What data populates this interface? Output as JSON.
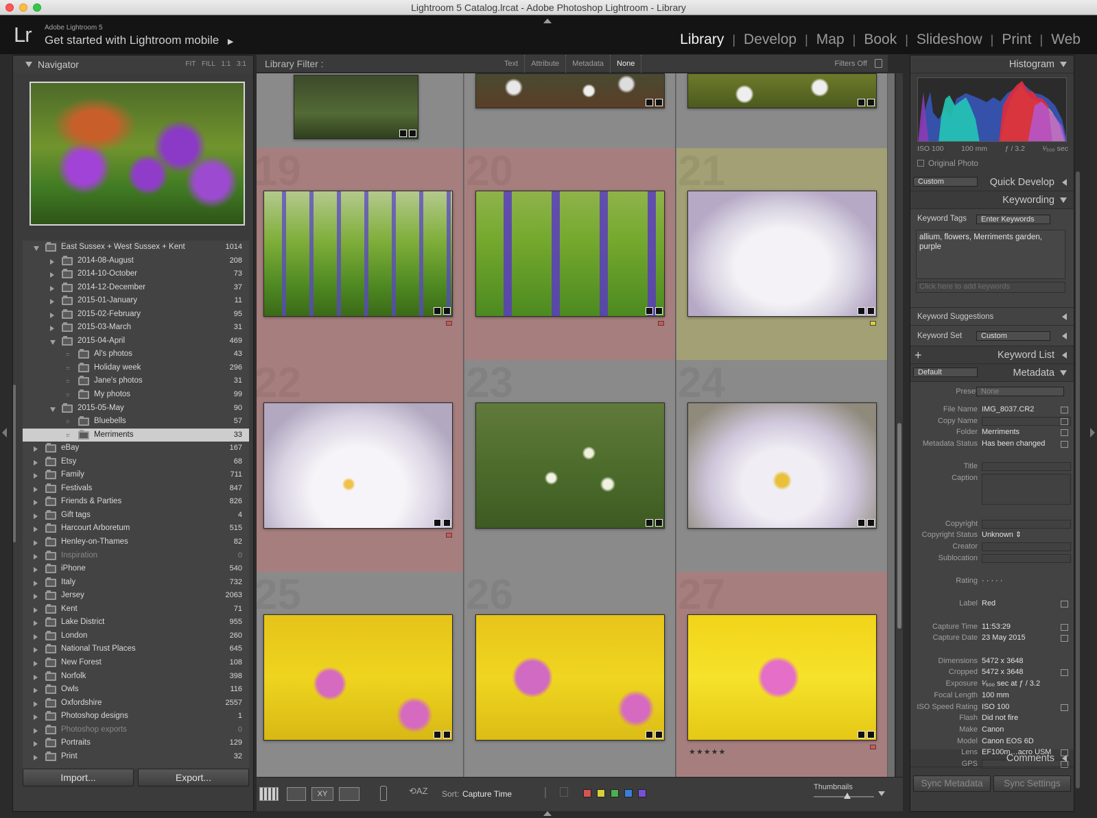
{
  "window": {
    "title": "Lightroom 5 Catalog.lrcat - Adobe Photoshop Lightroom - Library"
  },
  "identity": {
    "logo": "Lr",
    "version": "Adobe Lightroom 5",
    "mobile_prompt": "Get started with Lightroom mobile"
  },
  "modules": [
    "Library",
    "Develop",
    "Map",
    "Book",
    "Slideshow",
    "Print",
    "Web"
  ],
  "active_module": "Library",
  "navigator": {
    "title": "Navigator",
    "zoom": [
      "FIT",
      "FILL",
      "1:1",
      "3:1"
    ]
  },
  "folders": [
    {
      "name": "East Sussex + West Sussex + Kent",
      "count": "1014",
      "level": 0,
      "state": "open"
    },
    {
      "name": "2014-08-August",
      "count": "208",
      "level": 1,
      "state": "closed"
    },
    {
      "name": "2014-10-October",
      "count": "73",
      "level": 1,
      "state": "closed"
    },
    {
      "name": "2014-12-December",
      "count": "37",
      "level": 1,
      "state": "closed"
    },
    {
      "name": "2015-01-January",
      "count": "11",
      "level": 1,
      "state": "closed"
    },
    {
      "name": "2015-02-February",
      "count": "95",
      "level": 1,
      "state": "closed"
    },
    {
      "name": "2015-03-March",
      "count": "31",
      "level": 1,
      "state": "closed"
    },
    {
      "name": "2015-04-April",
      "count": "469",
      "level": 1,
      "state": "open"
    },
    {
      "name": "Al's photos",
      "count": "43",
      "level": 2,
      "state": "dot"
    },
    {
      "name": "Holiday week",
      "count": "296",
      "level": 2,
      "state": "dot"
    },
    {
      "name": "Jane's photos",
      "count": "31",
      "level": 2,
      "state": "dot"
    },
    {
      "name": "My photos",
      "count": "99",
      "level": 2,
      "state": "dot"
    },
    {
      "name": "2015-05-May",
      "count": "90",
      "level": 1,
      "state": "open"
    },
    {
      "name": "Bluebells",
      "count": "57",
      "level": 2,
      "state": "dot"
    },
    {
      "name": "Merriments",
      "count": "33",
      "level": 2,
      "state": "dot",
      "selected": true
    },
    {
      "name": "eBay",
      "count": "167",
      "level": 0,
      "state": "closed"
    },
    {
      "name": "Etsy",
      "count": "68",
      "level": 0,
      "state": "closed"
    },
    {
      "name": "Family",
      "count": "711",
      "level": 0,
      "state": "closed"
    },
    {
      "name": "Festivals",
      "count": "847",
      "level": 0,
      "state": "closed"
    },
    {
      "name": "Friends & Parties",
      "count": "826",
      "level": 0,
      "state": "closed"
    },
    {
      "name": "Gift tags",
      "count": "4",
      "level": 0,
      "state": "closed"
    },
    {
      "name": "Harcourt Arboretum",
      "count": "515",
      "level": 0,
      "state": "closed"
    },
    {
      "name": "Henley-on-Thames",
      "count": "82",
      "level": 0,
      "state": "closed"
    },
    {
      "name": "Inspiration",
      "count": "0",
      "level": 0,
      "state": "closed",
      "dim": true
    },
    {
      "name": "iPhone",
      "count": "540",
      "level": 0,
      "state": "closed"
    },
    {
      "name": "Italy",
      "count": "732",
      "level": 0,
      "state": "closed"
    },
    {
      "name": "Jersey",
      "count": "2063",
      "level": 0,
      "state": "closed"
    },
    {
      "name": "Kent",
      "count": "71",
      "level": 0,
      "state": "closed"
    },
    {
      "name": "Lake District",
      "count": "955",
      "level": 0,
      "state": "closed"
    },
    {
      "name": "London",
      "count": "260",
      "level": 0,
      "state": "closed"
    },
    {
      "name": "National Trust Places",
      "count": "645",
      "level": 0,
      "state": "closed"
    },
    {
      "name": "New Forest",
      "count": "108",
      "level": 0,
      "state": "closed"
    },
    {
      "name": "Norfolk",
      "count": "398",
      "level": 0,
      "state": "closed"
    },
    {
      "name": "Owls",
      "count": "116",
      "level": 0,
      "state": "closed"
    },
    {
      "name": "Oxfordshire",
      "count": "2557",
      "level": 0,
      "state": "closed"
    },
    {
      "name": "Photoshop designs",
      "count": "1",
      "level": 0,
      "state": "closed"
    },
    {
      "name": "Photoshop exports",
      "count": "0",
      "level": 0,
      "state": "closed",
      "dim": true
    },
    {
      "name": "Portraits",
      "count": "129",
      "level": 0,
      "state": "closed"
    },
    {
      "name": "Print",
      "count": "32",
      "level": 0,
      "state": "closed"
    }
  ],
  "left_buttons": {
    "import": "Import...",
    "export": "Export..."
  },
  "filter_bar": {
    "title": "Library Filter :",
    "tabs": [
      "Text",
      "Attribute",
      "Metadata",
      "None"
    ],
    "active": "None",
    "filters_state": "Filters Off"
  },
  "grid": {
    "cells": [
      {
        "num": "",
        "bg": "#8a8a8a",
        "img": "lupin-top",
        "label": ""
      },
      {
        "num": "",
        "bg": "#8a8a8a",
        "img": "white-flowers-top",
        "label": ""
      },
      {
        "num": "",
        "bg": "#8a8a8a",
        "img": "white-flowers-moss-top",
        "label": ""
      },
      {
        "num": "19",
        "bg": "#a77e7e",
        "img": "lupins",
        "label": "#d9534f"
      },
      {
        "num": "20",
        "bg": "#a77e7e",
        "img": "lupins-close",
        "label": "#d9534f"
      },
      {
        "num": "21",
        "bg": "#a2a074",
        "img": "white-iris",
        "label": "#d8cf3a"
      },
      {
        "num": "22",
        "bg": "#a77e7e",
        "img": "iris-2",
        "label": "#d9534f"
      },
      {
        "num": "23",
        "bg": "#8a8a8a",
        "img": "white-bells",
        "label": ""
      },
      {
        "num": "24",
        "bg": "#8a8a8a",
        "img": "iris-3",
        "label": ""
      },
      {
        "num": "25",
        "bg": "#8a8a8a",
        "img": "pink-yellow-1",
        "label": ""
      },
      {
        "num": "26",
        "bg": "#8a8a8a",
        "img": "pink-yellow-2",
        "label": ""
      },
      {
        "num": "27",
        "bg": "#a77e7e",
        "img": "pink-yellow-3",
        "label": "#d9534f",
        "stars": "★★★★★"
      }
    ]
  },
  "toolbar": {
    "sort_label": "Sort:",
    "sort_value": "Capture Time",
    "thumbnails_label": "Thumbnails",
    "colors": [
      "#d9534f",
      "#d8cf3a",
      "#4caf50",
      "#3b7fd6",
      "#7a4fd6"
    ]
  },
  "right": {
    "histogram": {
      "title": "Histogram",
      "iso": "ISO 100",
      "focal": "100 mm",
      "aperture": "ƒ / 3.2",
      "shutter": "¹⁄₅₀₀ sec",
      "original_photo": "Original Photo"
    },
    "quick_develop": {
      "title": "Quick Develop",
      "preset": "Custom"
    },
    "keywording": {
      "title": "Keywording",
      "tags_label": "Keyword Tags",
      "tags_mode": "Enter Keywords",
      "keywords": "allium, flowers, Merriments garden, purple",
      "add_placeholder": "Click here to add keywords",
      "suggestions": "Keyword Suggestions",
      "set_label": "Keyword Set",
      "set_value": "Custom"
    },
    "keyword_list": {
      "title": "Keyword List"
    },
    "metadata": {
      "title": "Metadata",
      "preset_dd": "Default",
      "preset_label": "Preset",
      "preset_value": "None",
      "rows": [
        {
          "k": "File Name",
          "v": "IMG_8037.CR2",
          "icon": true
        },
        {
          "k": "Copy Name",
          "v": "",
          "icon": true,
          "box": true
        },
        {
          "k": "Folder",
          "v": "Merriments",
          "icon": true
        },
        {
          "k": "Metadata Status",
          "v": "Has been changed",
          "icon": true
        },
        {
          "k": "",
          "v": ""
        },
        {
          "k": "Title",
          "v": "",
          "box": true
        },
        {
          "k": "Caption",
          "v": "",
          "box": true,
          "tall": true
        },
        {
          "k": "",
          "v": ""
        },
        {
          "k": "",
          "v": ""
        },
        {
          "k": "Copyright",
          "v": "",
          "box": true
        },
        {
          "k": "Copyright Status",
          "v": "Unknown ⇕"
        },
        {
          "k": "Creator",
          "v": "",
          "box": true
        },
        {
          "k": "Sublocation",
          "v": "",
          "box": true
        },
        {
          "k": "",
          "v": ""
        },
        {
          "k": "Rating",
          "v": "·  ·  ·  ·  ·"
        },
        {
          "k": "",
          "v": ""
        },
        {
          "k": "Label",
          "v": "Red",
          "icon": true
        },
        {
          "k": "",
          "v": ""
        },
        {
          "k": "Capture Time",
          "v": "11:53:29",
          "icon": true
        },
        {
          "k": "Capture Date",
          "v": "23 May 2015",
          "icon": true
        },
        {
          "k": "",
          "v": ""
        },
        {
          "k": "Dimensions",
          "v": "5472 x 3648"
        },
        {
          "k": "Cropped",
          "v": "5472 x 3648",
          "icon": true
        },
        {
          "k": "Exposure",
          "v": "¹⁄₅₀₀ sec at ƒ / 3.2"
        },
        {
          "k": "Focal Length",
          "v": "100 mm"
        },
        {
          "k": "ISO Speed Rating",
          "v": "ISO 100",
          "icon": true
        },
        {
          "k": "Flash",
          "v": "Did not fire"
        },
        {
          "k": "Make",
          "v": "Canon"
        },
        {
          "k": "Model",
          "v": "Canon EOS 6D"
        },
        {
          "k": "Lens",
          "v": "EF100m…acro USM",
          "icon": true
        },
        {
          "k": "GPS",
          "v": "",
          "icon": true,
          "box": true
        }
      ]
    },
    "comments": {
      "title": "Comments"
    },
    "sync_metadata": "Sync Metadata",
    "sync_settings": "Sync Settings"
  }
}
